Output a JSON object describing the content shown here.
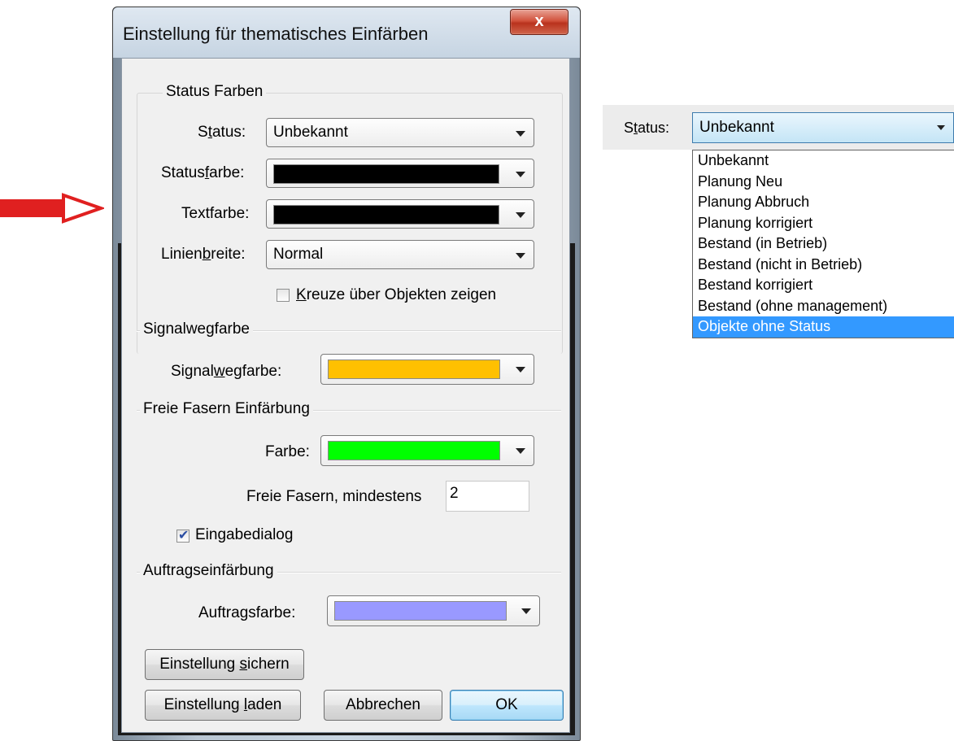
{
  "dialog": {
    "title": "Einstellung für thematisches Einfärben",
    "close_label": "x"
  },
  "status_colors": {
    "group_title": "Status Farben",
    "status_label_pre": "S",
    "status_label_u": "t",
    "status_label_post": "atus:",
    "status_value": "Unbekannt",
    "statusfarbe_label_pre": "Status",
    "statusfarbe_label_u": "f",
    "statusfarbe_label_post": "arbe:",
    "statusfarbe_color": "#000000",
    "textfarbe_label": "Textfarbe:",
    "textfarbe_color": "#000000",
    "linienbreite_label_pre": "Linien",
    "linienbreite_label_u": "b",
    "linienbreite_label_post": "reite:",
    "linienbreite_value": "Normal",
    "kreuze_label_u": "K",
    "kreuze_label_post": "reuze über Objekten zeigen",
    "kreuze_checked": false
  },
  "signal": {
    "group_title": "Signalwegfarbe",
    "label_pre": "Signal",
    "label_u": "w",
    "label_post": "egfarbe:",
    "color": "#ffc000"
  },
  "free_fibers": {
    "group_title": "Freie Fasern Einfärbung",
    "farbe_label": "Farbe:",
    "color": "#00ff00",
    "min_label": "Freie Fasern, mindestens",
    "min_value": "2",
    "eingabe_label": "Eingabedialog",
    "eingabe_checked": true
  },
  "order": {
    "group_title": "Auftragseinfärbung",
    "label": "Auftragsfarbe:",
    "color": "#9999ff"
  },
  "buttons": {
    "save_pre": "Einstellung ",
    "save_u": "s",
    "save_post": "ichern",
    "load_pre": "Einstellung ",
    "load_u": "l",
    "load_post": "aden",
    "cancel": "Abbrechen",
    "ok": "OK"
  },
  "dropdown": {
    "label_pre": "S",
    "label_u": "t",
    "label_post": "atus:",
    "value": "Unbekannt",
    "options": [
      "Unbekannt",
      "Planung Neu",
      "Planung Abbruch",
      "Planung korrigiert",
      "Bestand (in Betrieb)",
      "Bestand (nicht in Betrieb)",
      "Bestand korrigiert",
      "Bestand (ohne management)",
      "Objekte ohne Status"
    ],
    "selected_index": 8
  },
  "colors": {
    "arrow": "#e02020",
    "highlight": "#3399ff"
  }
}
